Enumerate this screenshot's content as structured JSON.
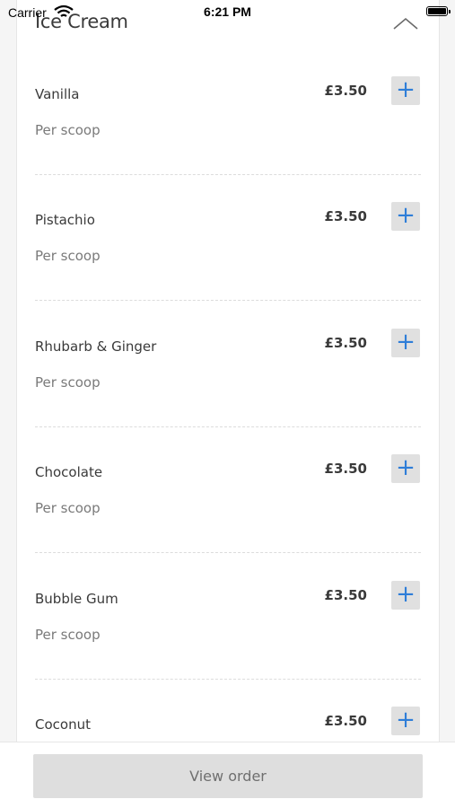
{
  "status_bar": {
    "carrier": "Carrier",
    "time": "6:21 PM"
  },
  "section": {
    "title": "Ice Cream"
  },
  "items": [
    {
      "name": "Vanilla",
      "price": "£3.50",
      "description": "Per scoop",
      "add_label": "+"
    },
    {
      "name": "Pistachio",
      "price": "£3.50",
      "description": "Per scoop",
      "add_label": "+"
    },
    {
      "name": "Rhubarb & Ginger",
      "price": "£3.50",
      "description": "Per scoop",
      "add_label": "+"
    },
    {
      "name": "Chocolate",
      "price": "£3.50",
      "description": "Per scoop",
      "add_label": "+"
    },
    {
      "name": "Bubble Gum",
      "price": "£3.50",
      "description": "Per scoop",
      "add_label": "+"
    },
    {
      "name": "Coconut",
      "price": "£3.50",
      "description": "",
      "add_label": "+"
    }
  ],
  "footer": {
    "view_order_label": "View order"
  },
  "colors": {
    "accent": "#2f7ed8",
    "button_bg": "#e0e0e0"
  }
}
